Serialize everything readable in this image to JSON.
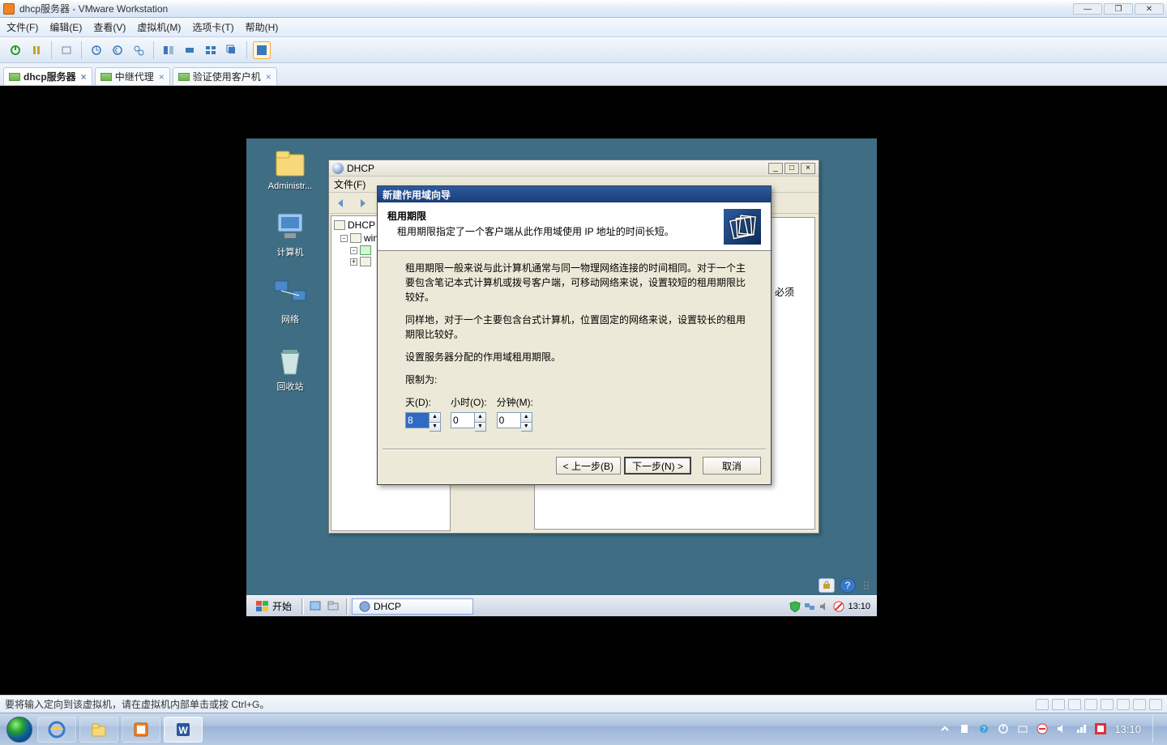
{
  "host": {
    "title": "dhcp服务器 - VMware Workstation",
    "menu": {
      "file": "文件(F)",
      "edit": "编辑(E)",
      "view": "查看(V)",
      "vm": "虚拟机(M)",
      "tabs": "选项卡(T)",
      "help": "帮助(H)"
    },
    "tabs": [
      {
        "label": "dhcp服务器",
        "active": true
      },
      {
        "label": "中继代理",
        "active": false
      },
      {
        "label": "验证使用客户机",
        "active": false
      }
    ],
    "status": "要将输入定向到该虚拟机，请在虚拟机内部单击或按 Ctrl+G。",
    "clock": "13:10"
  },
  "guest": {
    "desktop_icons": [
      {
        "label": "Administr..."
      },
      {
        "label": "计算机"
      },
      {
        "label": "网络"
      },
      {
        "label": "回收站"
      }
    ],
    "mmc": {
      "title": "DHCP",
      "menu_file": "文件(F)",
      "tree": {
        "root": "DHCP",
        "node1": "win",
        "node2_collapsed": true
      }
    },
    "wizard": {
      "title": "新建作用域向导",
      "heading": "租用期限",
      "subheading": "租用期限指定了一个客户端从此作用域使用 IP 地址的时间长短。",
      "para1": "租用期限一般来说与此计算机通常与同一物理网络连接的时间相同。对于一个主要包含笔记本式计算机或拨号客户端，可移动网络来说，设置较短的租用期限比较好。",
      "para2": "同样地，对于一个主要包含台式计算机，位置固定的网络来说，设置较长的租用期限比较好。",
      "para3": "设置服务器分配的作用域租用期限。",
      "limit_label": "限制为:",
      "fields": {
        "days_label": "天(D):",
        "hours_label": "小时(O):",
        "minutes_label": "分钟(M):",
        "days_value": "8",
        "hours_value": "0",
        "minutes_value": "0"
      },
      "buttons": {
        "back": "< 上一步(B)",
        "next": "下一步(N) >",
        "cancel": "取消"
      }
    },
    "behind": "必须",
    "taskbar": {
      "start": "开始",
      "task1": "DHCP",
      "clock": "13:10"
    }
  }
}
